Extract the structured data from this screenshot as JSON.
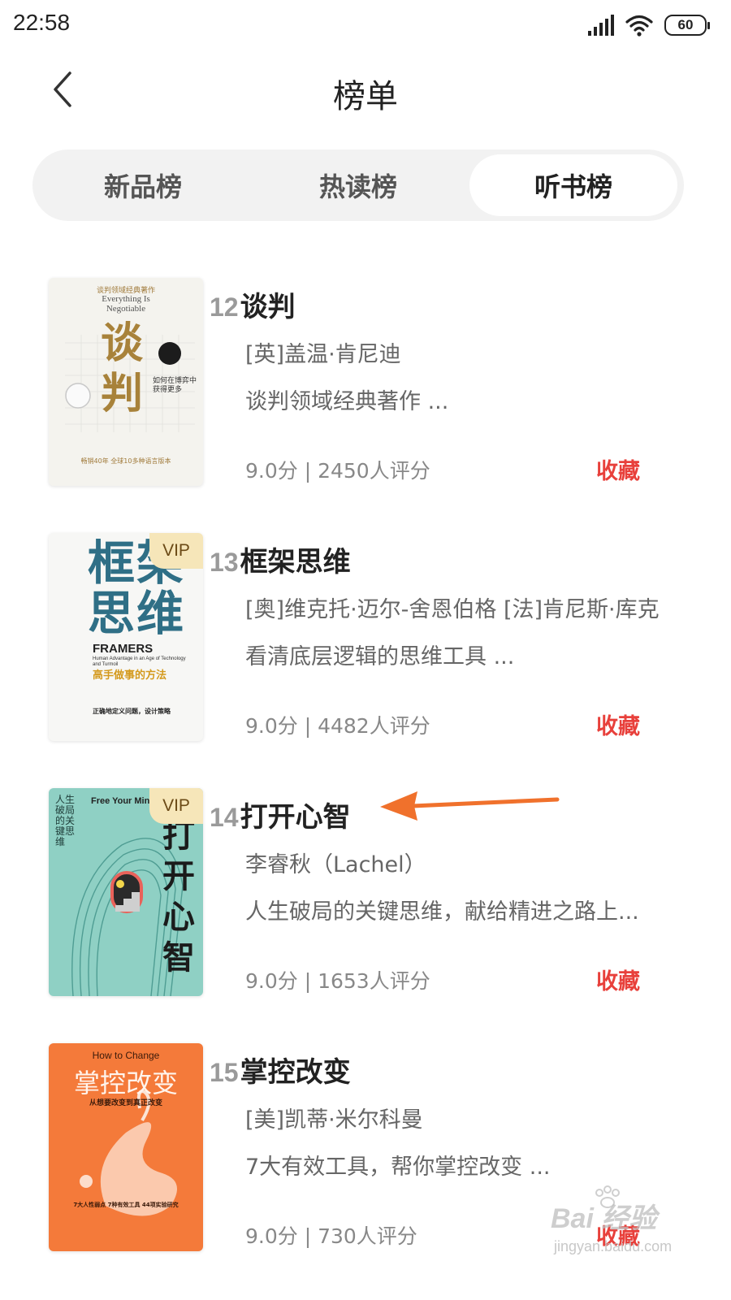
{
  "status_bar": {
    "time": "22:58",
    "battery": "60"
  },
  "nav": {
    "title": "榜单"
  },
  "tabs": [
    {
      "label": "新品榜",
      "active": false
    },
    {
      "label": "热读榜",
      "active": false
    },
    {
      "label": "听书榜",
      "active": true
    }
  ],
  "books": [
    {
      "rank": "12",
      "title": "谈判",
      "author": "[英]盖温·肯尼迪",
      "description": "谈判领域经典著作 ...",
      "rating": "9.0分 | 2450人评分",
      "collect_label": "收藏",
      "vip": false,
      "cover": {
        "top_line": "谈判领域经典著作",
        "en_title": "Everything Is Negotiable",
        "big_text": "谈判",
        "sub_title": "如何在博弈中获得更多",
        "bottom_line": "畅销40年 全球10多种语言版本"
      }
    },
    {
      "rank": "13",
      "title": "框架思维",
      "author": "[奥]维克托·迈尔-舍恩伯格 [法]肯尼斯·库克",
      "description": "看清底层逻辑的思维工具 ...",
      "rating": "9.0分 | 4482人评分",
      "collect_label": "收藏",
      "vip": true,
      "vip_label": "VIP",
      "cover": {
        "big_text": "框架思维",
        "en_title": "FRAMERS",
        "en_sub": "Human Advantage in an Age of Technology and Turmoil",
        "sub_title": "高手做事的方法",
        "bottom_line": "正确地定义问题，设计策略"
      }
    },
    {
      "rank": "14",
      "title": "打开心智",
      "author": "李睿秋（Lachel）",
      "description": "人生破局的关键思维，献给精进之路上...",
      "rating": "9.0分 | 1653人评分",
      "collect_label": "收藏",
      "vip": true,
      "vip_label": "VIP",
      "cover": {
        "en_title": "Free Your Mind",
        "side_text": "人生破局的关键思维",
        "big_text": "打开心智"
      }
    },
    {
      "rank": "15",
      "title": "掌控改变",
      "author": "[美]凯蒂·米尔科曼",
      "description": "7大有效工具，帮你掌控改变 ...",
      "rating": "9.0分 | 730人评分",
      "collect_label": "收藏",
      "vip": false,
      "cover": {
        "en_title": "How to Change",
        "big_text": "掌控改变",
        "sub_title": "从想要改变到真正改变",
        "bottom_line": "7大人性弱点 7种有效工具 44项实验研究"
      }
    }
  ],
  "watermark": {
    "main": "Bai 经验",
    "sub": "jingyan.baidu.com"
  },
  "colors": {
    "accent_red": "#e8403b",
    "tab_bg": "#f2f2f2",
    "vip_bg": "#f6e6b9",
    "arrow": "#f0712c"
  }
}
